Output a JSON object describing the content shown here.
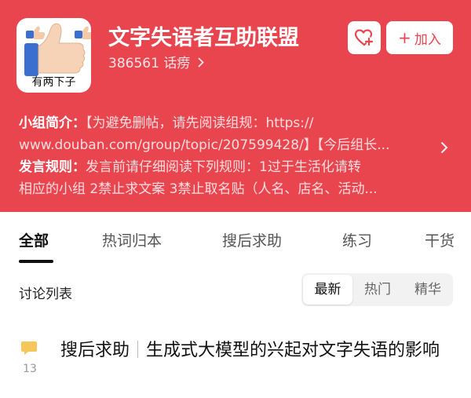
{
  "group": {
    "name": "文字失语者互助联盟",
    "member_count": "386561",
    "member_label": "话痨",
    "avatar_caption": "有两下子"
  },
  "actions": {
    "join_label": "加入"
  },
  "intro": {
    "label": "小组简介：",
    "line1": "【为避免删帖，请先阅读组规：https://",
    "line2": "www.douban.com/group/topic/207599428/】【今后组长..."
  },
  "rules": {
    "label": "发言规则：",
    "line1": "发言前请仔细阅读下列规则：1过于生活化请转",
    "line2": "相应的小组 2禁止求文案 3禁止取名贴（人名、店名、活动..."
  },
  "tabs": [
    "全部",
    "热词归本",
    "搜后求助",
    "练习",
    "干货"
  ],
  "discussion": {
    "title": "讨论列表",
    "sort_options": [
      "最新",
      "热门",
      "精华"
    ],
    "active_sort": "最新"
  },
  "posts": [
    {
      "comment_count": "13",
      "tag": "搜后求助",
      "title": "生成式大模型的兴起对文字失语的影响"
    }
  ],
  "colors": {
    "brand_red": "#e8454f",
    "comment_icon": "#f5c75a"
  }
}
